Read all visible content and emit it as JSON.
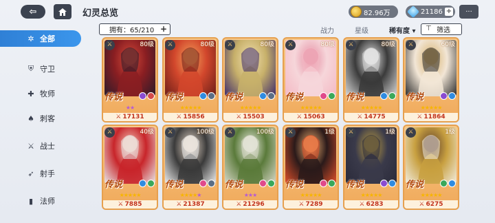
{
  "header": {
    "title": "幻灵总览",
    "back_icon": "back-arrow-icon",
    "home_icon": "home-icon",
    "gold": "82.96万",
    "gems": "21186",
    "plus": "+",
    "chat_glyph": "···"
  },
  "sidebar": {
    "items": [
      {
        "label": "全部",
        "icon": "star-icon",
        "glyph": "✲",
        "active": true
      },
      {
        "label": "守卫",
        "icon": "shield-icon",
        "glyph": "⛨",
        "active": false
      },
      {
        "label": "牧师",
        "icon": "heart-icon",
        "glyph": "✚",
        "active": false
      },
      {
        "label": "刺客",
        "icon": "dagger-icon",
        "glyph": "♠",
        "active": false
      },
      {
        "label": "战士",
        "icon": "sword-icon",
        "glyph": "⚔",
        "active": false
      },
      {
        "label": "射手",
        "icon": "bow-icon",
        "glyph": "➶",
        "active": false
      },
      {
        "label": "法师",
        "icon": "book-icon",
        "glyph": "▮",
        "active": false
      }
    ]
  },
  "filterbar": {
    "owned": "拥有：65/210",
    "owned_plus": "+",
    "tabs": [
      "战力",
      "星级",
      "稀有度 ▾"
    ],
    "filter_label": "筛选",
    "filter_glyph": "⊤"
  },
  "cards": [
    {
      "level": "80级",
      "rank": "传说",
      "stars_gold": "",
      "stars_purple": "★★",
      "power": "17131",
      "elements": [
        "#8a4bd0",
        "#d44a4a"
      ],
      "colors": [
        "#2a1b2a",
        "#8a1e22",
        "#d64b3a"
      ]
    },
    {
      "level": "80级",
      "rank": "传说",
      "stars_gold": "★★★★★",
      "stars_purple": "",
      "power": "15856",
      "elements": [
        "#2f8be0",
        "#5a6e86"
      ],
      "colors": [
        "#6b1e18",
        "#d2472c",
        "#f2a25c"
      ]
    },
    {
      "level": "80级",
      "rank": "传说",
      "stars_gold": "★★★★★",
      "stars_purple": "",
      "power": "15503",
      "elements": [
        "#2f8be0",
        "#5a6e86"
      ],
      "colors": [
        "#3d2a6a",
        "#c7b06a",
        "#f1e0b0"
      ]
    },
    {
      "level": "80级",
      "rank": "传说",
      "stars_gold": "★★★★★",
      "stars_purple": "",
      "power": "15063",
      "elements": [
        "#e04a8a",
        "#3aa85a"
      ],
      "colors": [
        "#f4b9c4",
        "#f6d6da",
        "#e48aa0"
      ]
    },
    {
      "level": "80级",
      "rank": "传说",
      "stars_gold": "★★★★★",
      "stars_purple": "",
      "power": "14775",
      "elements": [
        "#2f8be0",
        "#3aa85a"
      ],
      "colors": [
        "#d9d9d9",
        "#3a3a3a",
        "#f0f0f0"
      ]
    },
    {
      "level": "60级",
      "rank": "传说",
      "stars_gold": "★★★★★",
      "stars_purple": "",
      "power": "11864",
      "elements": [
        "#8a4bd0",
        "#2f8be0"
      ],
      "colors": [
        "#2a2a2a",
        "#f2e6d6",
        "#d6b06a"
      ]
    },
    {
      "level": "40级",
      "rank": "传说",
      "stars_gold": "★★★★★",
      "stars_purple": "",
      "power": "7885",
      "elements": [
        "#2f8be0",
        "#3aa85a"
      ],
      "colors": [
        "#e8e8e8",
        "#c8252a",
        "#f4d0c0"
      ]
    },
    {
      "level": "100级",
      "rank": "传说",
      "stars_gold": "★★★★",
      "stars_purple": "★",
      "power": "21387",
      "elements": [
        "#e04a8a",
        "#5a6e86"
      ],
      "colors": [
        "#efefef",
        "#3a3a3a",
        "#e8d8c8"
      ]
    },
    {
      "level": "100级",
      "rank": "传说",
      "stars_gold": "",
      "stars_purple": "★★★",
      "power": "21296",
      "elements": [
        "#e04a8a",
        "#3aa85a"
      ],
      "colors": [
        "#d8d8c8",
        "#5a7a3a",
        "#f0f0e8"
      ]
    },
    {
      "level": "1级",
      "rank": "传说",
      "stars_gold": "★★★★★",
      "stars_purple": "",
      "power": "7289",
      "elements": [
        "#e04a8a",
        "#3aa85a"
      ],
      "colors": [
        "#e0502a",
        "#2a1a1a",
        "#f3b070"
      ]
    },
    {
      "level": "1级",
      "rank": "传说",
      "stars_gold": "★★★★★",
      "stars_purple": "",
      "power": "6283",
      "elements": [
        "#8a4bd0",
        "#2f8be0"
      ],
      "colors": [
        "#2a2a3a",
        "#3a3a4a",
        "#c0a040"
      ]
    },
    {
      "level": "1级",
      "rank": "传说",
      "stars_gold": "★★★★★",
      "stars_purple": "",
      "power": "6275",
      "elements": [
        "#3aa85a",
        "#2f8be0"
      ],
      "colors": [
        "#f2ede0",
        "#c8a040",
        "#5a3a2a"
      ]
    }
  ]
}
